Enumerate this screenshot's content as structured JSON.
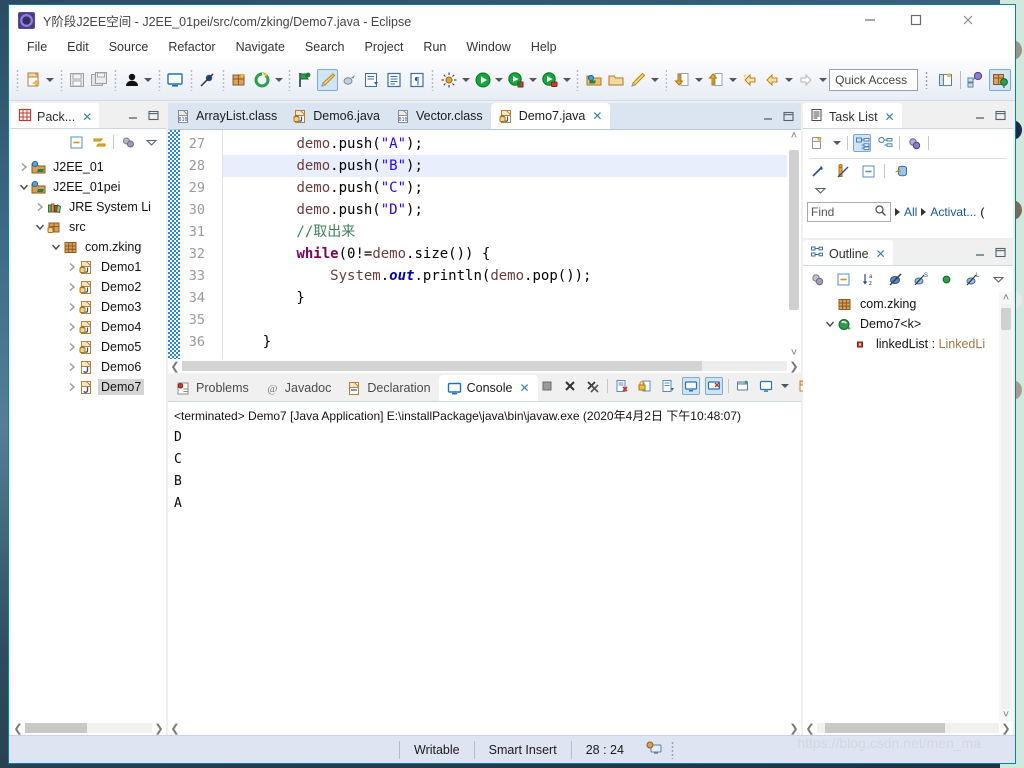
{
  "window": {
    "title": "Y阶段J2EE空间 - J2EE_01pei/src/com/zking/Demo7.java - Eclipse",
    "app_icon": "eclipse-icon",
    "minimize": "–",
    "maximize": "☐",
    "close": "✕"
  },
  "menubar": {
    "items": [
      "File",
      "Edit",
      "Source",
      "Refactor",
      "Navigate",
      "Search",
      "Project",
      "Run",
      "Window",
      "Help"
    ]
  },
  "toolbar": {
    "quick_access": "Quick Access",
    "icons": [
      "new-wizard-icon",
      "save-icon",
      "save-all-icon",
      "user-icon",
      "console-icon",
      "skip-breakpoints-icon",
      "new-package-icon",
      "refresh-icon",
      "debug-last-icon",
      "brush-icon",
      "annotation-icon",
      "external-tools-icon",
      "document-icon",
      "paragraph-icon",
      "run-ant-icon",
      "run-icon",
      "debug-icon",
      "run-last-tool-icon",
      "coverage-icon",
      "open-type-icon",
      "open-task-icon",
      "pencil-icon",
      "next-annotation-icon",
      "previous-annotation-icon",
      "back-icon",
      "forward-icon",
      "open-perspective-icon",
      "java-perspective-icon",
      "debug-perspective-icon"
    ]
  },
  "package_explorer": {
    "tab_label": "Pack...",
    "tab_close": "✕",
    "toolbar_icons": [
      "collapse-all-icon",
      "link-with-editor-icon",
      "view-menu-group-icon",
      "view-menu-icon"
    ],
    "tree": [
      {
        "label": "J2EE_01",
        "indent": 0,
        "twisty": "collapsed",
        "icon": "java-project-icon",
        "selected": false
      },
      {
        "label": "J2EE_01pei",
        "indent": 0,
        "twisty": "expanded",
        "icon": "java-project-icon",
        "selected": false
      },
      {
        "label": "JRE System Li",
        "indent": 1,
        "twisty": "collapsed",
        "icon": "jre-library-icon",
        "selected": false
      },
      {
        "label": "src",
        "indent": 1,
        "twisty": "expanded",
        "icon": "source-folder-icon",
        "selected": false
      },
      {
        "label": "com.zking",
        "indent": 2,
        "twisty": "expanded",
        "icon": "package-icon",
        "selected": false
      },
      {
        "label": "Demo1",
        "indent": 3,
        "twisty": "collapsed",
        "icon": "java-file-icon",
        "selected": false
      },
      {
        "label": "Demo2",
        "indent": 3,
        "twisty": "collapsed",
        "icon": "java-file-icon",
        "selected": false
      },
      {
        "label": "Demo3",
        "indent": 3,
        "twisty": "collapsed",
        "icon": "java-file-icon",
        "selected": false
      },
      {
        "label": "Demo4",
        "indent": 3,
        "twisty": "collapsed",
        "icon": "java-file-icon",
        "selected": false
      },
      {
        "label": "Demo5",
        "indent": 3,
        "twisty": "collapsed",
        "icon": "java-file-icon",
        "selected": false
      },
      {
        "label": "Demo6",
        "indent": 3,
        "twisty": "collapsed",
        "icon": "java-file-plain-icon",
        "selected": false
      },
      {
        "label": "Demo7",
        "indent": 3,
        "twisty": "collapsed",
        "icon": "java-file-plain-icon",
        "selected": true
      }
    ],
    "hscroll_left": "❮",
    "hscroll_right": "❯"
  },
  "editor": {
    "tabs": [
      {
        "label": "ArrayList.class",
        "icon": "class-file-icon",
        "active": false,
        "closable": false
      },
      {
        "label": "Demo6.java",
        "icon": "java-file-icon",
        "active": false,
        "closable": false
      },
      {
        "label": "Vector.class",
        "icon": "class-file-icon",
        "active": false,
        "closable": false
      },
      {
        "label": "Demo7.java",
        "icon": "java-file-icon",
        "active": true,
        "closable": true
      }
    ],
    "tab_close": "✕",
    "minimize": "▭",
    "maximize": "❐",
    "line_numbers": [
      "27",
      "28",
      "29",
      "30",
      "31",
      "32",
      "33",
      "34",
      "35",
      "36"
    ],
    "highlight_line_index": 1,
    "code_lines": [
      "        demo.push(\"A\");",
      "        demo.push(\"B\");",
      "        demo.push(\"C\");",
      "        demo.push(\"D\");",
      "        //取出来",
      "        while(0!=demo.size()) {",
      "            System.out.println(demo.pop());",
      "        }",
      "",
      "    }"
    ]
  },
  "bottom_panel": {
    "tabs": [
      {
        "label": "Problems",
        "icon": "problems-icon",
        "active": false,
        "closable": false
      },
      {
        "label": "Javadoc",
        "icon": "javadoc-icon",
        "active": false,
        "closable": false
      },
      {
        "label": "Declaration",
        "icon": "declaration-icon",
        "active": false,
        "closable": false
      },
      {
        "label": "Console",
        "icon": "console-icon",
        "active": true,
        "closable": true
      }
    ],
    "tab_close": "✕",
    "toolbar_icons": [
      "terminate-icon",
      "remove-launch-icon",
      "remove-all-terminated-icon",
      "clear-console-icon",
      "scroll-lock-icon",
      "word-wrap-icon",
      "pin-console-icon",
      "display-selected-console-icon",
      "open-console-icon",
      "new-console-view-icon",
      "view-menu-icon"
    ],
    "minimize": "▭",
    "maximize": "❐",
    "terminated_line": "<terminated> Demo7 [Java Application] E:\\installPackage\\java\\bin\\javaw.exe (2020年4月2日 下午10:48:07)",
    "output_lines": [
      "D",
      "C",
      "B",
      "A"
    ],
    "hscroll_left": "❮",
    "hscroll_right": "❯"
  },
  "task_list": {
    "tab_label": "Task List",
    "tab_close": "✕",
    "minimize": "▭",
    "maximize": "❐",
    "toolbar_icons": [
      "new-task-icon",
      "new-task-menu-icon",
      "categorized-presentation-icon",
      "scheduled-presentation-icon",
      "synchronize-changed-icon",
      "focus-on-workweek-icon",
      "show-ui-legend-icon",
      "collapse-all-icon",
      "restore-tasks-icon",
      "view-menu-icon"
    ],
    "find_placeholder": "Find",
    "find_value": "",
    "search_icon": "search-icon",
    "filter_all": "All",
    "filter_activate": "Activat...",
    "filter_more": "("
  },
  "outline": {
    "tab_label": "Outline",
    "tab_close": "✕",
    "minimize": "▭",
    "maximize": "❐",
    "toolbar_icons": [
      "synchronize-icon",
      "collapse-all-icon",
      "sort-icon",
      "hide-fields-icon",
      "hide-static-icon",
      "hide-nonpublic-icon",
      "hide-local-types-icon",
      "view-menu-icon"
    ],
    "tree": [
      {
        "label": "com.zking",
        "indent": 1,
        "twisty": "none",
        "icon": "package-icon"
      },
      {
        "label": "Demo7<k>",
        "indent": 1,
        "twisty": "expanded",
        "icon": "class-icon"
      },
      {
        "label": "linkedList : LinkedLi",
        "indent": 2,
        "twisty": "none",
        "icon": "private-field-icon"
      }
    ],
    "hscroll_left": "❮",
    "hscroll_right": "❯",
    "vscroll_up": "˄",
    "vscroll_down": "˅"
  },
  "statusbar": {
    "writable": "Writable",
    "insert_mode": "Smart Insert",
    "position": "28 : 24",
    "icon": "remote-systems-icon"
  },
  "watermark": "https://blog.csdn.net/men_ma",
  "colors": {
    "accent_blue": "#0d7ca1",
    "tab_active_bg": "#ffffff",
    "editor_tab_bar": "#dbe5f1",
    "selection": "#e8eefb",
    "status_bar": "#dfe4f2",
    "keyword": "#7f0055",
    "string": "#2a00ff",
    "comment": "#3f7f5f",
    "field": "#0000c0",
    "desktop_panel": "#cfe9dc"
  }
}
